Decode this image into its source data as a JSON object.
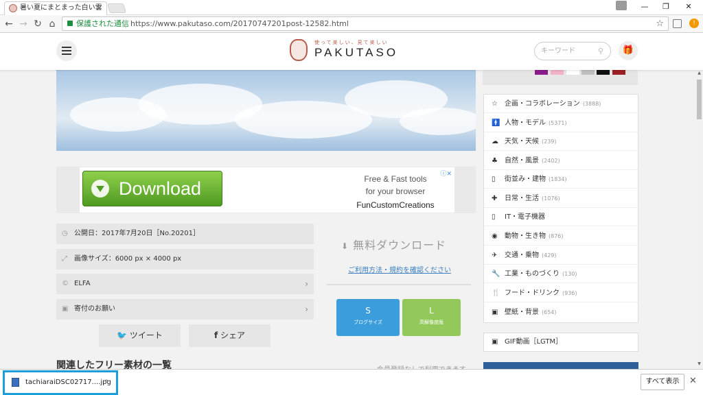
{
  "browser": {
    "tab_title": "暑い夏にまとまった白い雲",
    "tab_close": "×",
    "secure_label": "保護された通信",
    "url": "https://www.pakutaso.com/20170747201post-12582.html",
    "bookmark_icon": "☆",
    "ext_badge": "!",
    "window": {
      "minimize": "—",
      "restore": "❐",
      "close": "✕"
    },
    "nav": {
      "back": "←",
      "forward": "→",
      "reload": "↻",
      "home": "⌂"
    }
  },
  "site": {
    "tagline": "使って楽しい、見て楽しい",
    "logo": "PAKUTASO",
    "search_placeholder": "キーワード",
    "search_icon": "⚲",
    "gift_icon": "🎁"
  },
  "ad": {
    "button_label": "Download",
    "line1": "Free & Fast tools",
    "line2": "for your browser",
    "line3": "FunCustomCreations",
    "adchoices": "ⓘ✕"
  },
  "info": {
    "published": "公開日：2017年7月20日［No.20201］",
    "image_size": "画像サイズ：6000 px × 4000 px",
    "author": "ELFA",
    "donate": "寄付のお願い",
    "chevron": "›",
    "icons": {
      "published": "◷",
      "size": "⤢",
      "author": "©",
      "donate": "▣"
    }
  },
  "share": {
    "tweet_icon": "🐦",
    "tweet": "ツイート",
    "facebook_icon": "f",
    "share": "シェア"
  },
  "download": {
    "icon": "⬇",
    "title": "無料ダウンロード",
    "terms_link": "ご利用方法・規約を確認ください",
    "small": {
      "label": "S",
      "sub": "ブログサイズ",
      "color": "#3c9ddc"
    },
    "large": {
      "label": "L",
      "sub": "高解像度版",
      "color": "#93c95b"
    }
  },
  "related": {
    "heading": "関連したフリー素材の一覧",
    "note": "会員登録なしで利用できます"
  },
  "sidebar": {
    "swatch_colors": [
      "#ffffff",
      "#8b1a8b",
      "#f2b3c9",
      "#ffffff",
      "#c0c0c0",
      "#111111",
      "#9a1f24"
    ],
    "categories": [
      {
        "icon": "☆",
        "label": "企画・コラボレーション",
        "count": "(3888)"
      },
      {
        "icon": "🚹",
        "label": "人物・モデル",
        "count": "(5371)"
      },
      {
        "icon": "☁",
        "label": "天気・天候",
        "count": "(239)"
      },
      {
        "icon": "♣",
        "label": "自然・風景",
        "count": "(2402)"
      },
      {
        "icon": "▯",
        "label": "街並み・建物",
        "count": "(1834)"
      },
      {
        "icon": "✚",
        "label": "日常・生活",
        "count": "(1076)"
      },
      {
        "icon": "▯",
        "label": "IT・電子機器",
        "count": ""
      },
      {
        "icon": "◉",
        "label": "動物・生き物",
        "count": "(876)"
      },
      {
        "icon": "✈",
        "label": "交通・乗物",
        "count": "(429)"
      },
      {
        "icon": "🔧",
        "label": "工業・ものづくり",
        "count": "(130)"
      },
      {
        "icon": "🍴",
        "label": "フード・ドリンク",
        "count": "(936)"
      },
      {
        "icon": "▣",
        "label": "壁紙・背景",
        "count": "(654)"
      }
    ],
    "gif": {
      "icon": "▣",
      "label": "GIF動画［LGTM］"
    }
  },
  "shelf": {
    "filename": "tachiaraiDSC02717....jpg",
    "caret": "^",
    "show_all": "すべて表示",
    "close": "✕"
  }
}
